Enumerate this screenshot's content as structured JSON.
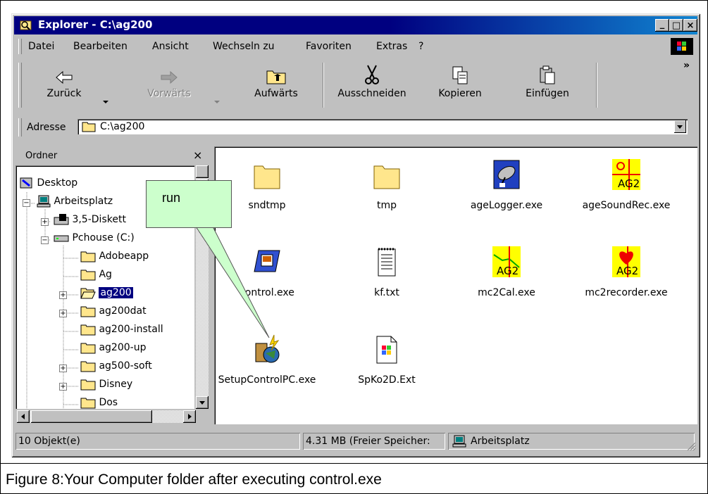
{
  "window": {
    "title": "Explorer - C:\\ag200",
    "minimize": "_",
    "maximize": "□",
    "close": "×"
  },
  "menu": [
    "Datei",
    "Bearbeiten",
    "Ansicht",
    "Wechseln zu",
    "Favoriten",
    "Extras",
    "?"
  ],
  "toolbar": {
    "back": "Zurück",
    "forward": "Vorwärts",
    "up": "Aufwärts",
    "cut": "Ausschneiden",
    "copy": "Kopieren",
    "paste": "Einfügen",
    "more": "»"
  },
  "address": {
    "label": "Adresse",
    "value": "C:\\ag200"
  },
  "folders_pane": {
    "title": "Ordner",
    "close": "×",
    "tree": [
      "Desktop",
      "Arbeitsplatz",
      "3,5-Diskett",
      "Pchouse (C:)",
      "Adobeapp",
      "Ag",
      "ag200",
      "ag200dat",
      "ag200-install",
      "ag200-up",
      "ag500-soft",
      "Disney",
      "Dos"
    ],
    "selected": "ag200"
  },
  "files": [
    {
      "name": "sndtmp",
      "icon": "folder-icon"
    },
    {
      "name": "tmp",
      "icon": "folder-icon"
    },
    {
      "name": "ageLogger.exe",
      "icon": "satellite-dish-icon"
    },
    {
      "name": "ageSoundRec.exe",
      "icon": "ag2-chart-icon"
    },
    {
      "name": "control.exe",
      "icon": "monitor-window-icon"
    },
    {
      "name": "kf.txt",
      "icon": "text-file-icon"
    },
    {
      "name": "mc2Cal.exe",
      "icon": "ag2-chart-icon"
    },
    {
      "name": "mc2recorder.exe",
      "icon": "ag2-heart-icon"
    },
    {
      "name": "SetupControlPC.exe",
      "icon": "setup-globe-icon"
    },
    {
      "name": "SpKo2D.Ext",
      "icon": "windows-file-icon"
    }
  ],
  "status": {
    "count": "10 Objekt(e)",
    "free": "4.31 MB (Freier Speicher:",
    "location": "Arbeitsplatz"
  },
  "callout": {
    "text": "run"
  },
  "caption": "Figure 8:Your Computer folder after executing control.exe",
  "colors": {
    "titlebar": "#000080",
    "face": "#c0c0c0",
    "callout": "#ccffcc",
    "folder": "#ffe68c"
  }
}
